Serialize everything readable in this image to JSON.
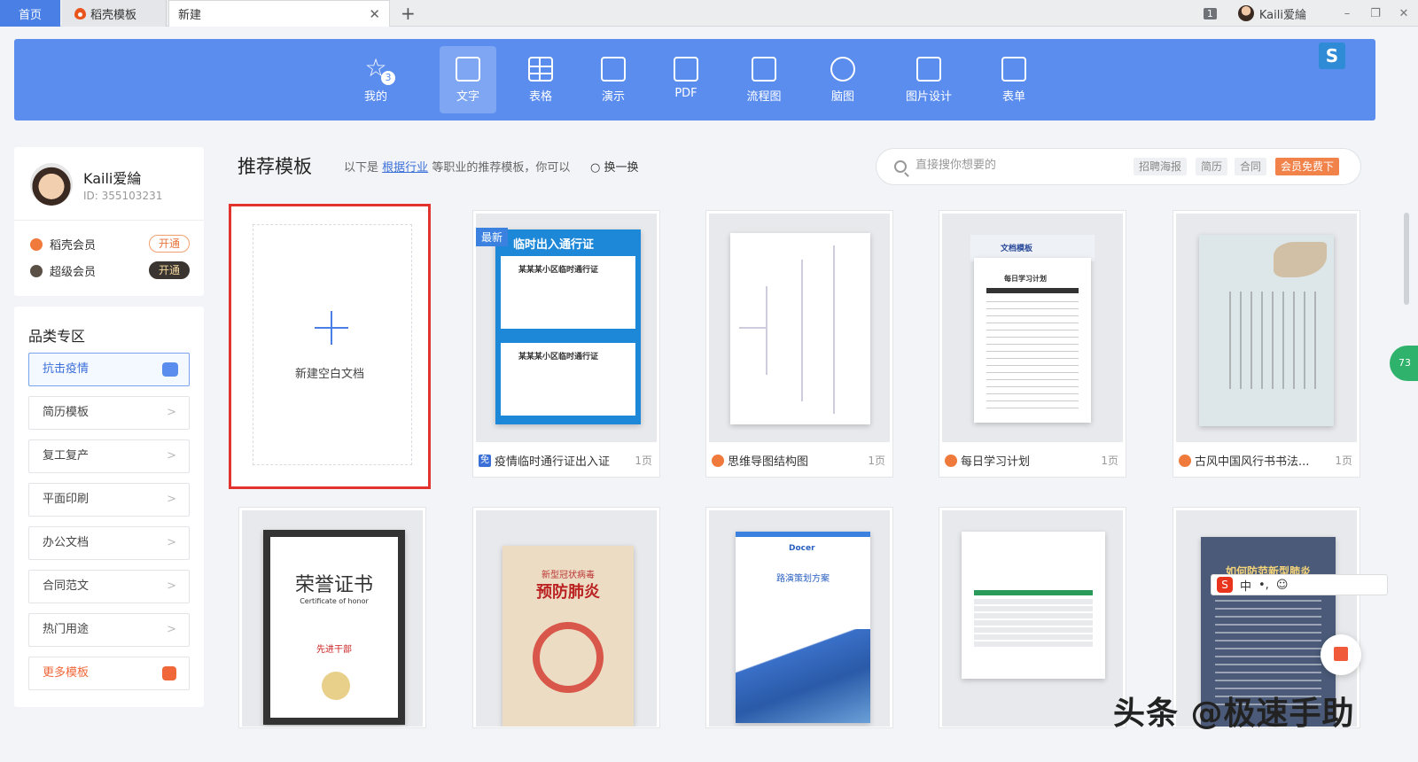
{
  "tabs": {
    "home": "首页",
    "daoke": "稻壳模板",
    "new": "新建",
    "close": "✕",
    "add": "+"
  },
  "window": {
    "badge": "1",
    "user": "Kaili爱綸",
    "minimize": "–",
    "restore": "❐",
    "close": "✕"
  },
  "toolbar": {
    "mine_label": "我的",
    "mine_count": "3",
    "items": [
      "文字",
      "表格",
      "演示",
      "PDF",
      "流程图",
      "脑图",
      "图片设计",
      "表单"
    ],
    "active": "文字",
    "logo": "S"
  },
  "profile": {
    "name": "Kaili爱綸",
    "id": "ID: 355103231",
    "members": [
      {
        "label": "稻壳会员",
        "button": "开通"
      },
      {
        "label": "超级会员",
        "button": "开通"
      }
    ]
  },
  "category": {
    "title": "品类专区",
    "items": [
      "抗击疫情",
      "简历模板",
      "复工复产",
      "平面印刷",
      "办公文档",
      "合同范文",
      "热门用途",
      "更多模板"
    ],
    "chev": ">"
  },
  "main": {
    "title": "推荐模板",
    "sub_prefix": "以下是",
    "sub_link": "根据行业",
    "sub_suffix": "等职业的推荐模板，你可以",
    "refresh": "换一换",
    "refresh_icon": "○"
  },
  "search": {
    "placeholder": "直接搜你想要的",
    "tags": [
      "招聘海报",
      "简历",
      "合同"
    ],
    "vip": "会员免费下"
  },
  "newdoc": {
    "label": "新建空白文档"
  },
  "cards": [
    {
      "title": "疫情临时通行证出入证",
      "pages": "1页",
      "badge": "最新",
      "free": "免"
    },
    {
      "title": "思维导图结构图",
      "pages": "1页"
    },
    {
      "title": "每日学习计划",
      "pages": "1页"
    },
    {
      "title": "古风中国风行书书法...",
      "pages": "1页"
    }
  ],
  "thumb_text": {
    "pass_header": "临时出入通行证",
    "pass_title": "某某某小区临时通行证",
    "plan_brand": "文档模板",
    "plan_title": "每日学习计划",
    "honor_title": "荣誉证书",
    "honor_sub": "Certificate of honor",
    "honor_name": "先进干部",
    "virus_title": "新型冠状病毒",
    "virus_big": "预防肺炎",
    "roadshow": "路演策划方案",
    "docer": "Docer",
    "poster_title": "如何防范新型肺炎"
  },
  "ime": {
    "s": "S",
    "chars": [
      "中",
      "•,",
      "☺"
    ]
  },
  "float": {
    "green": "73"
  },
  "watermark": "头条 @极速手助"
}
